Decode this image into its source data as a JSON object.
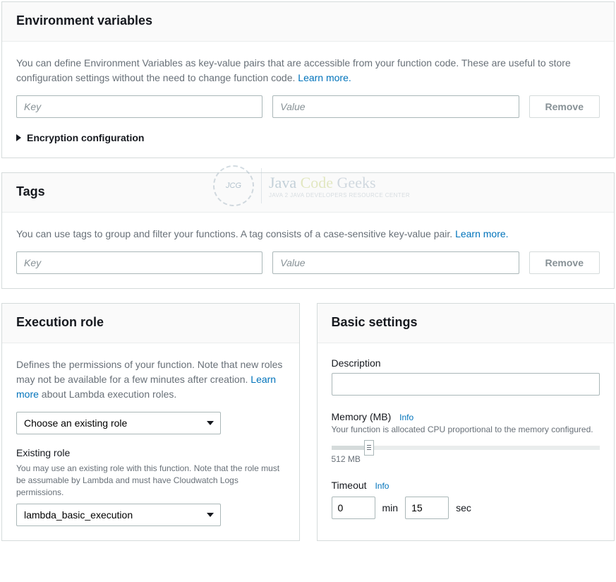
{
  "env": {
    "title": "Environment variables",
    "desc": "You can define Environment Variables as key-value pairs that are accessible from your function code. These are useful to store configuration settings without the need to change function code. ",
    "learn_more": "Learn more.",
    "key_placeholder": "Key",
    "value_placeholder": "Value",
    "remove_label": "Remove",
    "encryption_label": "Encryption configuration"
  },
  "tags": {
    "title": "Tags",
    "desc": "You can use tags to group and filter your functions. A tag consists of a case-sensitive key-value pair. ",
    "learn_more": "Learn more.",
    "key_placeholder": "Key",
    "value_placeholder": "Value",
    "remove_label": "Remove"
  },
  "role": {
    "title": "Execution role",
    "desc_pre": "Defines the permissions of your function. Note that new roles may not be available for a few minutes after creation. ",
    "learn_more": "Learn more",
    "desc_post": " about Lambda execution roles.",
    "choose_label": "Choose an existing role",
    "existing_label": "Existing role",
    "existing_sub": "You may use an existing role with this function. Note that the role must be assumable by Lambda and must have Cloudwatch Logs permissions.",
    "existing_value": "lambda_basic_execution"
  },
  "basic": {
    "title": "Basic settings",
    "desc_label": "Description",
    "desc_value": "",
    "memory_label": "Memory (MB)",
    "info": "Info",
    "memory_sub": "Your function is allocated CPU proportional to the memory configured.",
    "memory_value": "512 MB",
    "timeout_label": "Timeout",
    "timeout_min": "0",
    "timeout_min_unit": "min",
    "timeout_sec": "15",
    "timeout_sec_unit": "sec"
  },
  "watermark": {
    "badge": "JCG",
    "brand_w1": "Java",
    "brand_w2": "Code",
    "brand_w3": "Geeks",
    "tagline": "JAVA 2 JAVA DEVELOPERS RESOURCE CENTER"
  }
}
